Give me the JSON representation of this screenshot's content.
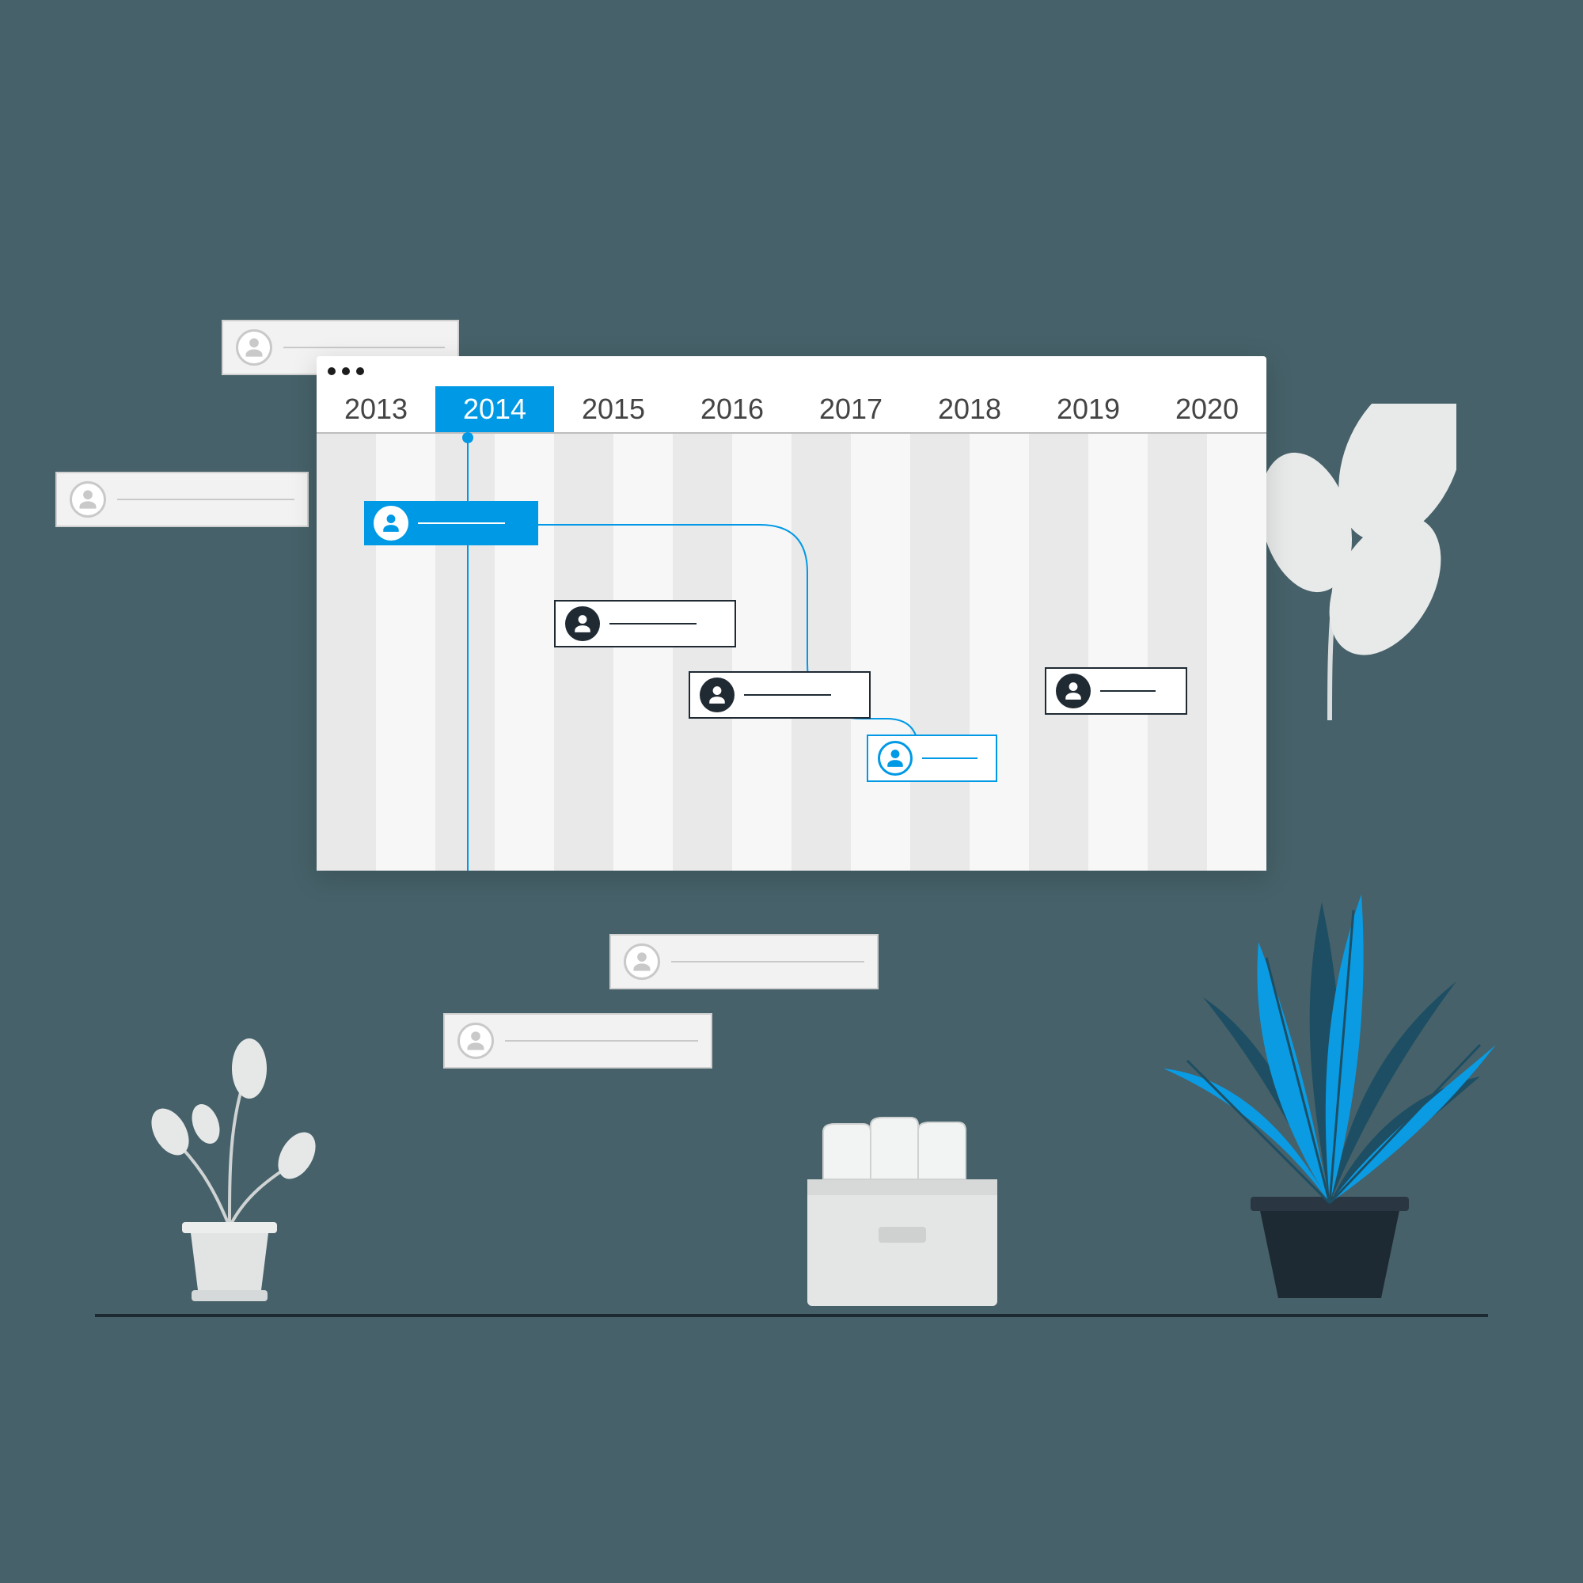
{
  "timeline": {
    "years": [
      "2013",
      "2014",
      "2015",
      "2016",
      "2017",
      "2018",
      "2019",
      "2020"
    ],
    "active_index": 1
  },
  "colors": {
    "accent": "#0099e5",
    "dark": "#1f2a33",
    "bg": "#466169"
  },
  "icons": {
    "person": "person-icon",
    "window_dot": "window-control-dot"
  }
}
